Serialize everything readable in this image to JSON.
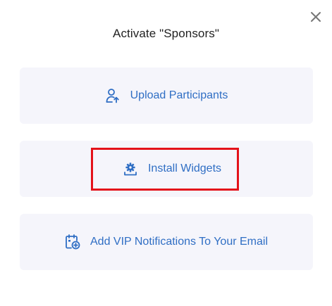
{
  "dialog": {
    "title": "Activate \"Sponsors\"",
    "close_icon": "close-icon"
  },
  "options": [
    {
      "label": "Upload Participants",
      "icon": "user-upload-icon"
    },
    {
      "label": "Install Widgets",
      "icon": "gear-install-icon"
    },
    {
      "label": "Add VIP Notifications To Your Email",
      "icon": "calendar-add-icon"
    }
  ],
  "colors": {
    "accent": "#2f6ec4",
    "card_background": "#f5f5fb",
    "highlight_border": "#e4121a",
    "title_text": "#222222",
    "close_icon": "#777777"
  }
}
